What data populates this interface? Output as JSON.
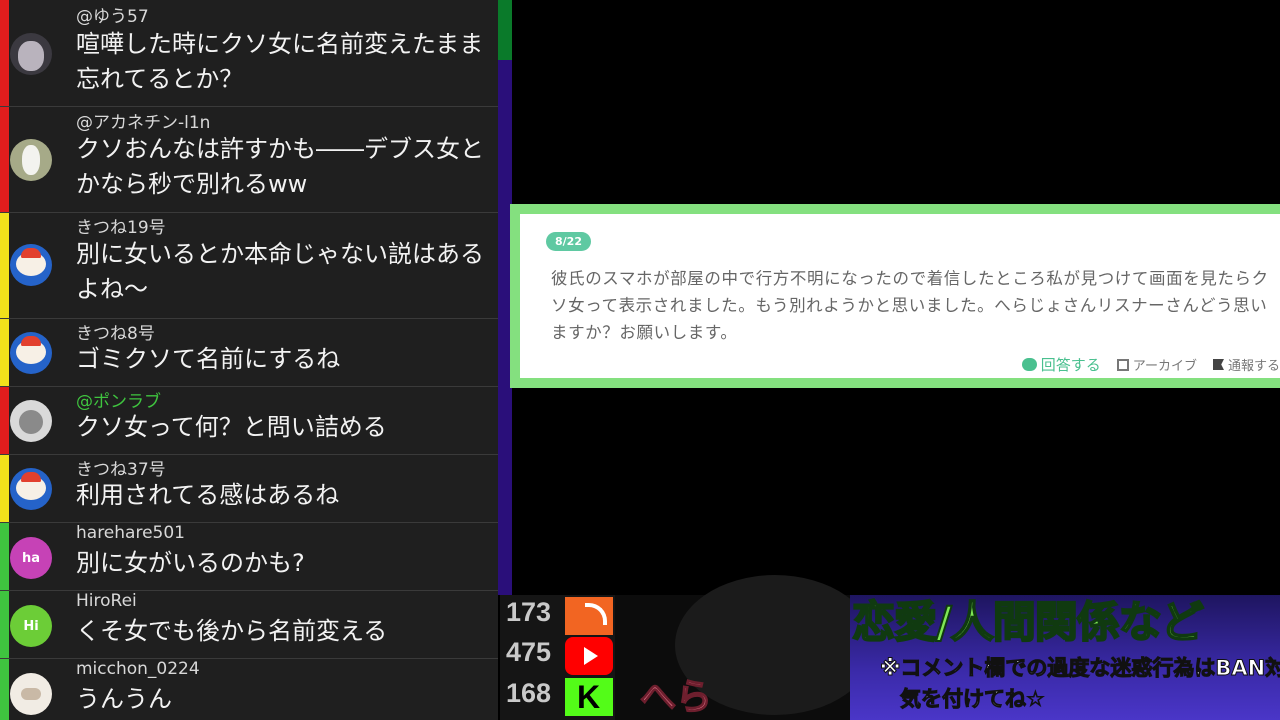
{
  "chat": {
    "messages": [
      {
        "author": "@ゆう57",
        "text": "喧嘩した時にクソ女に名前変えたまま忘れてるとか？",
        "bar_color": "#e11d1d",
        "avatar": "dark-avatar"
      },
      {
        "author": "@アカネチン-l1n",
        "text": "クソおんなは許すかも――デブス女とかなら秒で別れるww",
        "bar_color": "#e11d1d",
        "avatar": "rabbit-avatar"
      },
      {
        "author": "きつね19号",
        "text": "別に女いるとか本命じゃない説はあるよね～",
        "bar_color": "#f2e21b",
        "avatar": "fox-avatar"
      },
      {
        "author": "きつね8号",
        "text": "ゴミクソて名前にするね",
        "bar_color": "#f2e21b",
        "avatar": "fox-avatar"
      },
      {
        "author": "@ポンラブ",
        "text": "クソ女って何？と問い詰める",
        "bar_color": "#e11d1d",
        "avatar": "cat-avatar",
        "author_color": "#3fc43f"
      },
      {
        "author": "きつね37号",
        "text": "利用されてる感はあるね",
        "bar_color": "#f2e21b",
        "avatar": "fox-avatar"
      },
      {
        "author": "harehare501",
        "text": "別に女がいるのかも?",
        "bar_color": "#3fc43f",
        "avatar": "ha"
      },
      {
        "author": "HiroRei",
        "text": "くそ女でも後から名前変える",
        "bar_color": "#3fc43f",
        "avatar": "Hi"
      },
      {
        "author": "micchon_0224",
        "text": "うんうん",
        "bar_color": "#3fc43f",
        "avatar": "cat-sleep-avatar"
      }
    ]
  },
  "card": {
    "date": "8/22",
    "question": "彼氏のスマホが部屋の中で行方不明になったので着信したところ私が見つけて画面を見たらクソ女って表示されました。もう別れようかと思いました。へらじょさんリスナーさんどう思いますか？お願いします。",
    "actions": {
      "answer": "回答する",
      "archive": "アーカイブ",
      "report": "通報する"
    },
    "border_color": "#84e07f"
  },
  "counters": {
    "rss": "173",
    "youtube": "475",
    "kick": "168"
  },
  "overlay": {
    "hera": "へら",
    "banner_title": "恋愛/人間関係など",
    "notice_line1": "※コメント欄での過度な迷惑行為はBAN対象",
    "notice_line2": "気を付けてね☆"
  }
}
